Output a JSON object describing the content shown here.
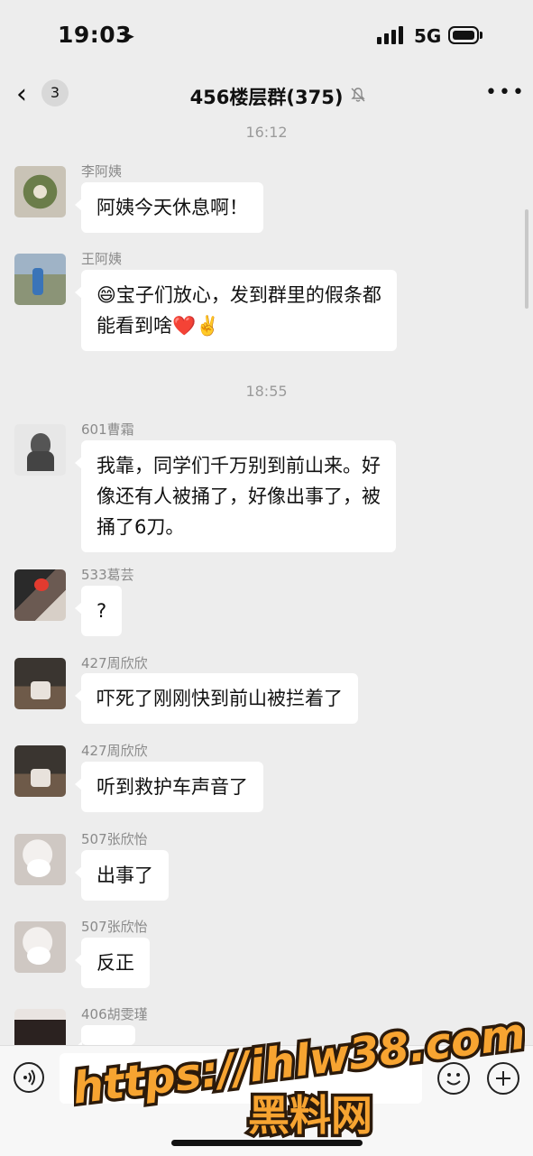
{
  "status": {
    "time": "19:03",
    "network": "5G"
  },
  "nav": {
    "badge": "3",
    "title": "456楼层群(375)"
  },
  "timestamps": [
    "16:12",
    "18:55"
  ],
  "messages": [
    {
      "sender": "李阿姨",
      "text": "阿姨今天休息啊！"
    },
    {
      "sender": "王阿姨",
      "text": "😄宝子们放心，发到群里的假条都\n能看到啥❤️✌️"
    },
    {
      "sender": "601曹霜",
      "text": "我靠，同学们千万别到前山来。好\n像还有人被捅了，好像出事了，被\n捅了6刀。"
    },
    {
      "sender": "533葛芸",
      "text": "?"
    },
    {
      "sender": "427周欣欣",
      "text": "吓死了刚刚快到前山被拦着了"
    },
    {
      "sender": "427周欣欣",
      "text": "听到救护车声音了"
    },
    {
      "sender": "507张欣怡",
      "text": "出事了"
    },
    {
      "sender": "507张欣怡",
      "text": "反正"
    },
    {
      "sender": "406胡雯瑾",
      "text": ""
    }
  ],
  "watermark": {
    "line1": "https://ihlw38.com",
    "line2": "黑料网"
  },
  "colors": {
    "background": "#ededed",
    "bubble": "#ffffff",
    "watermark_fill": "#f7a431",
    "watermark_stroke": "#2b1a0b"
  }
}
